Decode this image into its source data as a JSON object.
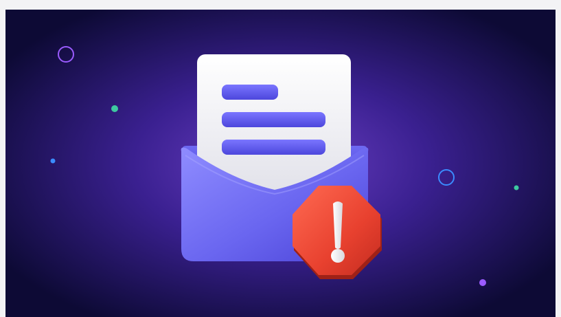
{
  "image": {
    "subject": "email-alert-illustration",
    "colors": {
      "page_background": "#f3f3f5",
      "background_center": "#6b3fc4",
      "background_edge": "#0d0a35",
      "envelope": "#6a66f0",
      "envelope_light": "#8f8cff",
      "envelope_dark": "#4a42d6",
      "letter_paper": "#f4f4f6",
      "text_lines": "#5d57ea",
      "warning_badge": "#e8412f",
      "warning_mark": "#f2f2f2",
      "accent_green": "#3ec9a0",
      "accent_blue": "#3b8cff",
      "accent_purple": "#9b5bff"
    },
    "icons": [
      "envelope-icon",
      "letter-icon",
      "warning-icon"
    ]
  }
}
